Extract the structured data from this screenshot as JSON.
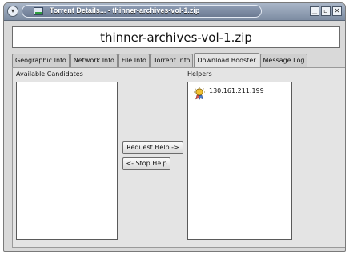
{
  "window": {
    "title": "Torrent Details... - thinner-archives-vol-1.zip",
    "menu_glyph": "▾",
    "buttons": {
      "minimize": "▁",
      "maximize": "▫",
      "close": "✕"
    }
  },
  "filename": "thinner-archives-vol-1.zip",
  "tabs": [
    {
      "label": "Geographic Info",
      "active": false
    },
    {
      "label": "Network Info",
      "active": false
    },
    {
      "label": "File Info",
      "active": false
    },
    {
      "label": "Torrent Info",
      "active": false
    },
    {
      "label": "Download Booster",
      "active": true
    },
    {
      "label": "Message Log",
      "active": false
    }
  ],
  "booster": {
    "candidates_label": "Available Candidates",
    "helpers_label": "Helpers",
    "request_button": "Request Help ->",
    "stop_button": "<- Stop Help",
    "candidates": [],
    "helpers": [
      {
        "address": "130.161.211.199",
        "icon": "helper-peer-icon"
      }
    ]
  }
}
